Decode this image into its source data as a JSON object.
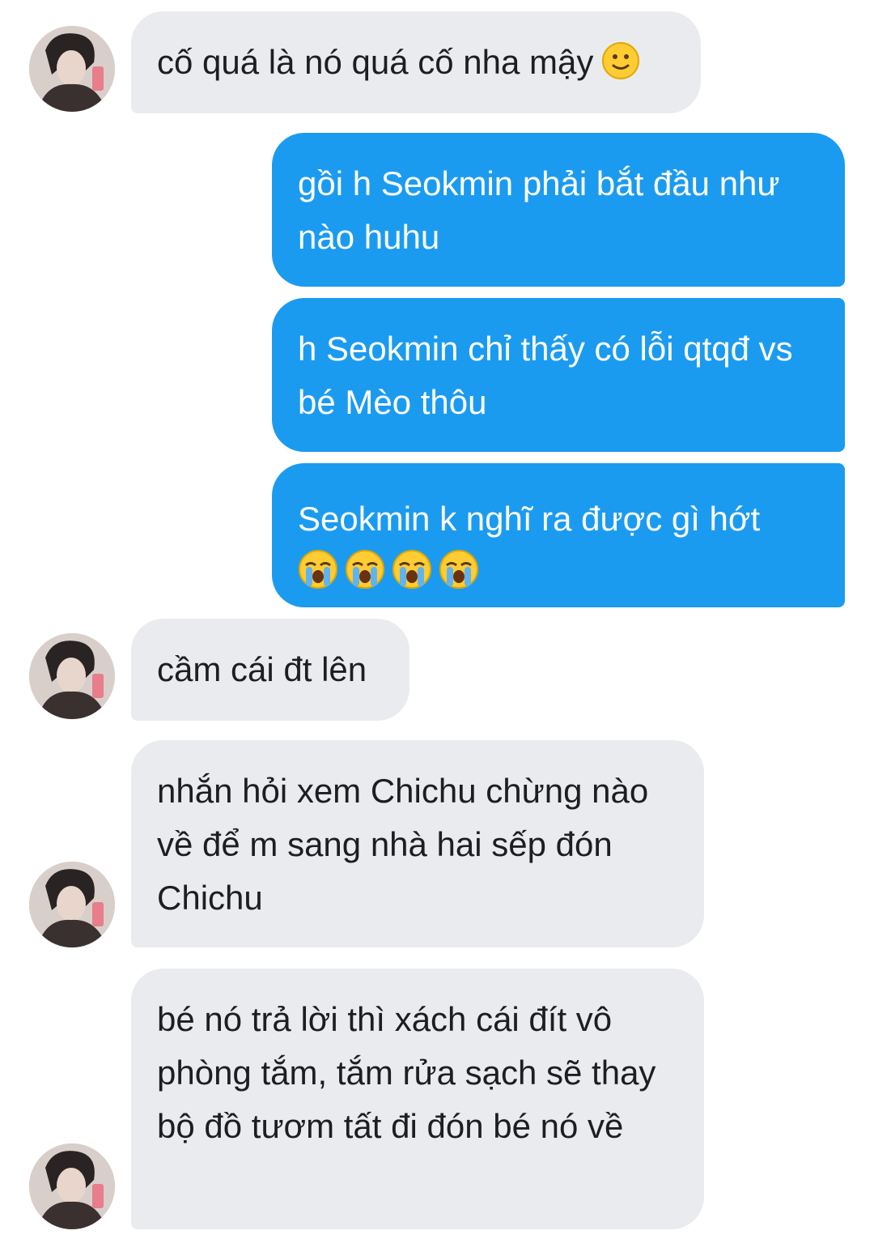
{
  "messages": [
    {
      "from": "them",
      "text": "cố quá là nó quá cố nha mậy",
      "emoji": "slightly-smiling-face"
    },
    {
      "from": "me",
      "text": "gồi h Seokmin phải bắt đầu như nào huhu"
    },
    {
      "from": "me",
      "text": "h Seokmin chỉ thấy có lỗi qtqđ vs bé Mèo thôu"
    },
    {
      "from": "me",
      "text": "Seokmin k nghĩ ra được gì hớt",
      "emoji": "loudly-crying-face",
      "emoji_count": 4
    },
    {
      "from": "them",
      "text": "cầm cái đt lên"
    },
    {
      "from": "them",
      "text": "nhắn hỏi xem Chichu chừng nào về để m sang nhà hai sếp đón Chichu"
    },
    {
      "from": "them",
      "text": "bé nó trả lời thì xách cái đít vô phòng tắm, tắm rửa sạch sẽ thay bộ đồ tươm tất đi đón bé nó về"
    }
  ],
  "colors": {
    "incoming_bubble": "#e9ebee",
    "outgoing_bubble": "#1b9bf0",
    "incoming_text": "#1c1e21",
    "outgoing_text": "#ffffff"
  }
}
